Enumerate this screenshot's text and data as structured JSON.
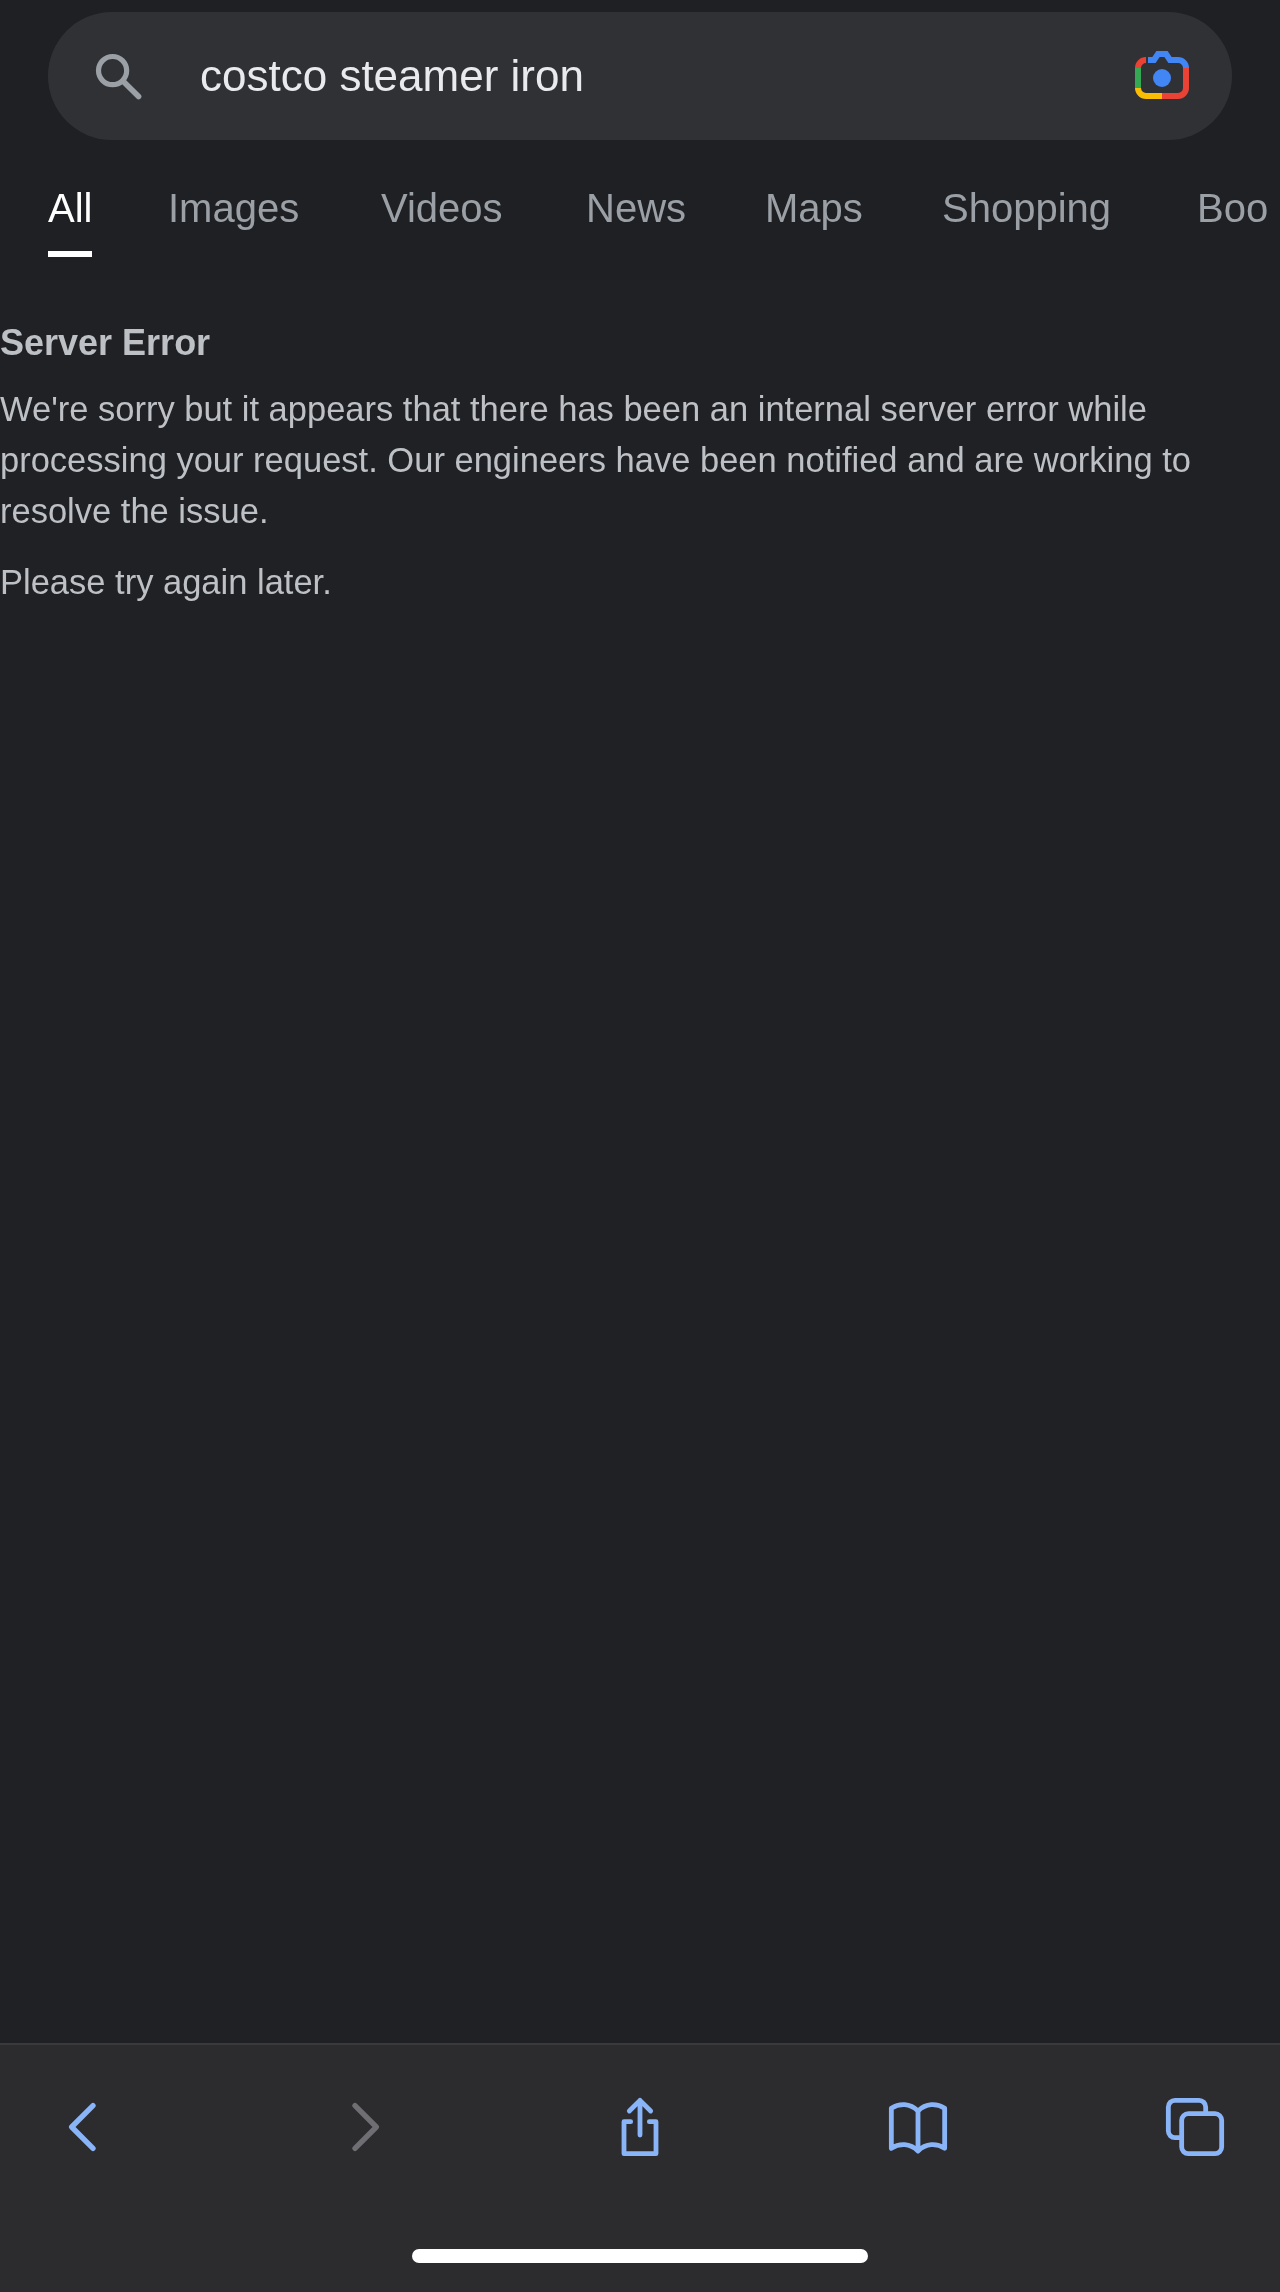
{
  "search": {
    "value": "costco steamer iron"
  },
  "tabs": [
    {
      "label": "All",
      "selected": true
    },
    {
      "label": "Images",
      "selected": false
    },
    {
      "label": "Videos",
      "selected": false
    },
    {
      "label": "News",
      "selected": false
    },
    {
      "label": "Maps",
      "selected": false
    },
    {
      "label": "Shopping",
      "selected": false
    },
    {
      "label": "Boo",
      "selected": false
    }
  ],
  "error": {
    "title": "Server Error",
    "message": "We're sorry but it appears that there has been an internal server error while processing your request. Our engineers have been notified and are working to resolve the issue.",
    "hint": "Please try again later."
  },
  "toolbar": [
    {
      "kind": "back",
      "disabled": false
    },
    {
      "kind": "forward",
      "disabled": true
    },
    {
      "kind": "share",
      "disabled": false
    },
    {
      "kind": "bookmarks",
      "disabled": false
    },
    {
      "kind": "tabs",
      "disabled": false
    }
  ]
}
